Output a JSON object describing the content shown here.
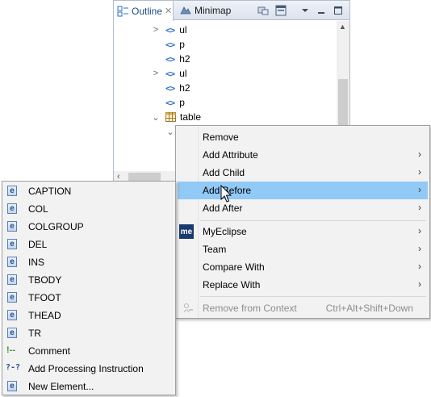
{
  "tabs": {
    "outline_label": "Outline",
    "minimap_label": "Minimap",
    "close_glyph": "✕"
  },
  "tree": {
    "nodes": [
      {
        "label": "ul",
        "expandable": true
      },
      {
        "label": "p",
        "expandable": false
      },
      {
        "label": "h2",
        "expandable": false
      },
      {
        "label": "ul",
        "expandable": true
      },
      {
        "label": "h2",
        "expandable": false
      },
      {
        "label": "p",
        "expandable": false
      },
      {
        "label": "table",
        "expandable": true,
        "expanded": true
      }
    ],
    "tag_icon": "<>"
  },
  "context_menu": {
    "items": [
      {
        "label": "Remove"
      },
      {
        "label": "Add Attribute",
        "submenu": true
      },
      {
        "label": "Add Child",
        "submenu": true
      },
      {
        "label": "Add Before",
        "submenu": true,
        "highlighted": true
      },
      {
        "label": "Add After",
        "submenu": true
      },
      {
        "label": "MyEclipse",
        "submenu": true,
        "icon": "me"
      },
      {
        "label": "Team",
        "submenu": true
      },
      {
        "label": "Compare With",
        "submenu": true
      },
      {
        "label": "Replace With",
        "submenu": true
      },
      {
        "label": "Remove from Context",
        "accelerator": "Ctrl+Alt+Shift+Down",
        "disabled": true
      }
    ],
    "arrow_glyph": "›"
  },
  "submenu": {
    "items": [
      {
        "label": "CAPTION",
        "icon": "e"
      },
      {
        "label": "COL",
        "icon": "e"
      },
      {
        "label": "COLGROUP",
        "icon": "e"
      },
      {
        "label": "DEL",
        "icon": "e"
      },
      {
        "label": "INS",
        "icon": "e"
      },
      {
        "label": "TBODY",
        "icon": "e"
      },
      {
        "label": "TFOOT",
        "icon": "e"
      },
      {
        "label": "THEAD",
        "icon": "e"
      },
      {
        "label": "TR",
        "icon": "e"
      },
      {
        "label": "Comment",
        "icon": "comment"
      },
      {
        "label": "Add Processing Instruction",
        "icon": "pi"
      },
      {
        "label": "New Element...",
        "icon": "e"
      }
    ],
    "icon_glyphs": {
      "e": "e",
      "comment": "!--",
      "pi": "?-?"
    }
  },
  "colors": {
    "highlight": "#91c9f7",
    "tag_icon": "#2a6fc9",
    "menu_bg": "#f2f2f2"
  }
}
